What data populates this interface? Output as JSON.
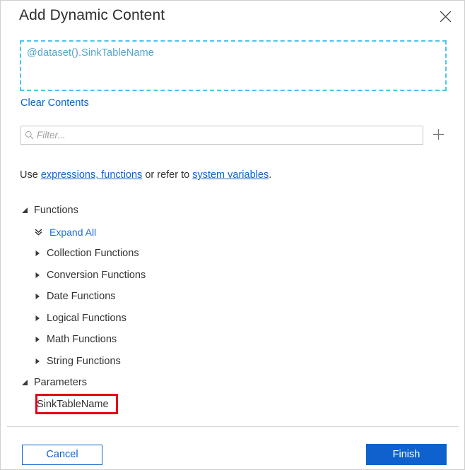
{
  "dialog": {
    "title": "Add Dynamic Content",
    "close_icon": "close-icon"
  },
  "expression": {
    "value": "@dataset().SinkTableName",
    "clear_label": "Clear Contents"
  },
  "filter": {
    "placeholder": "Filter...",
    "value": "",
    "search_icon": "search-icon",
    "add_icon": "plus-icon"
  },
  "hint": {
    "prefix": "Use ",
    "link1": "expressions, functions",
    "middle": " or refer to ",
    "link2": "system variables",
    "suffix": "."
  },
  "tree": {
    "functions_group": "Functions",
    "expand_all": "Expand All",
    "expand_all_icon": "double-chevron-down-icon",
    "function_categories": [
      "Collection Functions",
      "Conversion Functions",
      "Date Functions",
      "Logical Functions",
      "Math Functions",
      "String Functions"
    ],
    "parameters_group": "Parameters",
    "parameters": [
      "SinkTableName"
    ]
  },
  "footer": {
    "cancel_label": "Cancel",
    "finish_label": "Finish"
  },
  "colors": {
    "accent": "#0f62cd",
    "link": "#1a6ddb",
    "expression_text": "#4fa5ce",
    "expression_border": "#4ec3ef",
    "annotation": "#e2001a",
    "text": "#323130"
  }
}
